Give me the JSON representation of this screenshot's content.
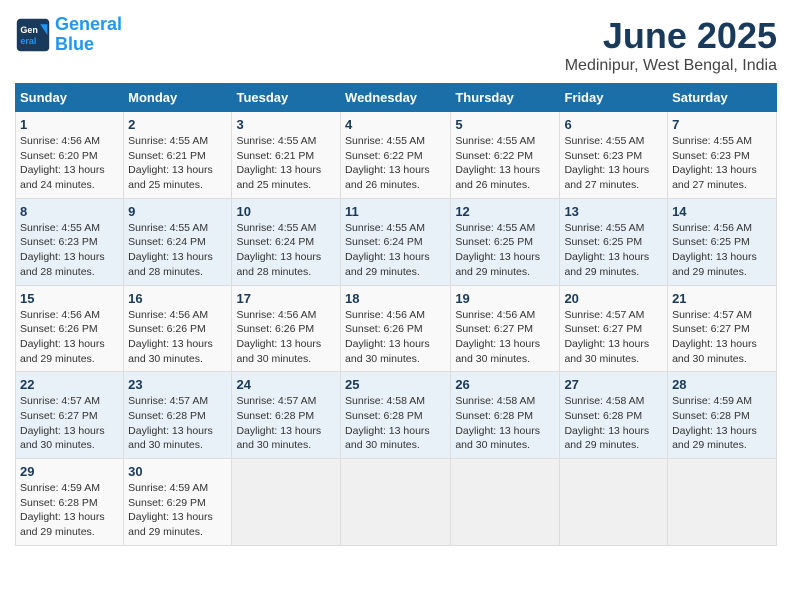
{
  "logo": {
    "line1": "General",
    "line2": "Blue"
  },
  "title": "June 2025",
  "subtitle": "Medinipur, West Bengal, India",
  "days_of_week": [
    "Sunday",
    "Monday",
    "Tuesday",
    "Wednesday",
    "Thursday",
    "Friday",
    "Saturday"
  ],
  "weeks": [
    [
      {
        "day": "1",
        "info": "Sunrise: 4:56 AM\nSunset: 6:20 PM\nDaylight: 13 hours\nand 24 minutes."
      },
      {
        "day": "2",
        "info": "Sunrise: 4:55 AM\nSunset: 6:21 PM\nDaylight: 13 hours\nand 25 minutes."
      },
      {
        "day": "3",
        "info": "Sunrise: 4:55 AM\nSunset: 6:21 PM\nDaylight: 13 hours\nand 25 minutes."
      },
      {
        "day": "4",
        "info": "Sunrise: 4:55 AM\nSunset: 6:22 PM\nDaylight: 13 hours\nand 26 minutes."
      },
      {
        "day": "5",
        "info": "Sunrise: 4:55 AM\nSunset: 6:22 PM\nDaylight: 13 hours\nand 26 minutes."
      },
      {
        "day": "6",
        "info": "Sunrise: 4:55 AM\nSunset: 6:23 PM\nDaylight: 13 hours\nand 27 minutes."
      },
      {
        "day": "7",
        "info": "Sunrise: 4:55 AM\nSunset: 6:23 PM\nDaylight: 13 hours\nand 27 minutes."
      }
    ],
    [
      {
        "day": "8",
        "info": "Sunrise: 4:55 AM\nSunset: 6:23 PM\nDaylight: 13 hours\nand 28 minutes."
      },
      {
        "day": "9",
        "info": "Sunrise: 4:55 AM\nSunset: 6:24 PM\nDaylight: 13 hours\nand 28 minutes."
      },
      {
        "day": "10",
        "info": "Sunrise: 4:55 AM\nSunset: 6:24 PM\nDaylight: 13 hours\nand 28 minutes."
      },
      {
        "day": "11",
        "info": "Sunrise: 4:55 AM\nSunset: 6:24 PM\nDaylight: 13 hours\nand 29 minutes."
      },
      {
        "day": "12",
        "info": "Sunrise: 4:55 AM\nSunset: 6:25 PM\nDaylight: 13 hours\nand 29 minutes."
      },
      {
        "day": "13",
        "info": "Sunrise: 4:55 AM\nSunset: 6:25 PM\nDaylight: 13 hours\nand 29 minutes."
      },
      {
        "day": "14",
        "info": "Sunrise: 4:56 AM\nSunset: 6:25 PM\nDaylight: 13 hours\nand 29 minutes."
      }
    ],
    [
      {
        "day": "15",
        "info": "Sunrise: 4:56 AM\nSunset: 6:26 PM\nDaylight: 13 hours\nand 29 minutes."
      },
      {
        "day": "16",
        "info": "Sunrise: 4:56 AM\nSunset: 6:26 PM\nDaylight: 13 hours\nand 30 minutes."
      },
      {
        "day": "17",
        "info": "Sunrise: 4:56 AM\nSunset: 6:26 PM\nDaylight: 13 hours\nand 30 minutes."
      },
      {
        "day": "18",
        "info": "Sunrise: 4:56 AM\nSunset: 6:26 PM\nDaylight: 13 hours\nand 30 minutes."
      },
      {
        "day": "19",
        "info": "Sunrise: 4:56 AM\nSunset: 6:27 PM\nDaylight: 13 hours\nand 30 minutes."
      },
      {
        "day": "20",
        "info": "Sunrise: 4:57 AM\nSunset: 6:27 PM\nDaylight: 13 hours\nand 30 minutes."
      },
      {
        "day": "21",
        "info": "Sunrise: 4:57 AM\nSunset: 6:27 PM\nDaylight: 13 hours\nand 30 minutes."
      }
    ],
    [
      {
        "day": "22",
        "info": "Sunrise: 4:57 AM\nSunset: 6:27 PM\nDaylight: 13 hours\nand 30 minutes."
      },
      {
        "day": "23",
        "info": "Sunrise: 4:57 AM\nSunset: 6:28 PM\nDaylight: 13 hours\nand 30 minutes."
      },
      {
        "day": "24",
        "info": "Sunrise: 4:57 AM\nSunset: 6:28 PM\nDaylight: 13 hours\nand 30 minutes."
      },
      {
        "day": "25",
        "info": "Sunrise: 4:58 AM\nSunset: 6:28 PM\nDaylight: 13 hours\nand 30 minutes."
      },
      {
        "day": "26",
        "info": "Sunrise: 4:58 AM\nSunset: 6:28 PM\nDaylight: 13 hours\nand 30 minutes."
      },
      {
        "day": "27",
        "info": "Sunrise: 4:58 AM\nSunset: 6:28 PM\nDaylight: 13 hours\nand 29 minutes."
      },
      {
        "day": "28",
        "info": "Sunrise: 4:59 AM\nSunset: 6:28 PM\nDaylight: 13 hours\nand 29 minutes."
      }
    ],
    [
      {
        "day": "29",
        "info": "Sunrise: 4:59 AM\nSunset: 6:28 PM\nDaylight: 13 hours\nand 29 minutes."
      },
      {
        "day": "30",
        "info": "Sunrise: 4:59 AM\nSunset: 6:29 PM\nDaylight: 13 hours\nand 29 minutes."
      },
      {
        "day": "",
        "info": ""
      },
      {
        "day": "",
        "info": ""
      },
      {
        "day": "",
        "info": ""
      },
      {
        "day": "",
        "info": ""
      },
      {
        "day": "",
        "info": ""
      }
    ]
  ]
}
